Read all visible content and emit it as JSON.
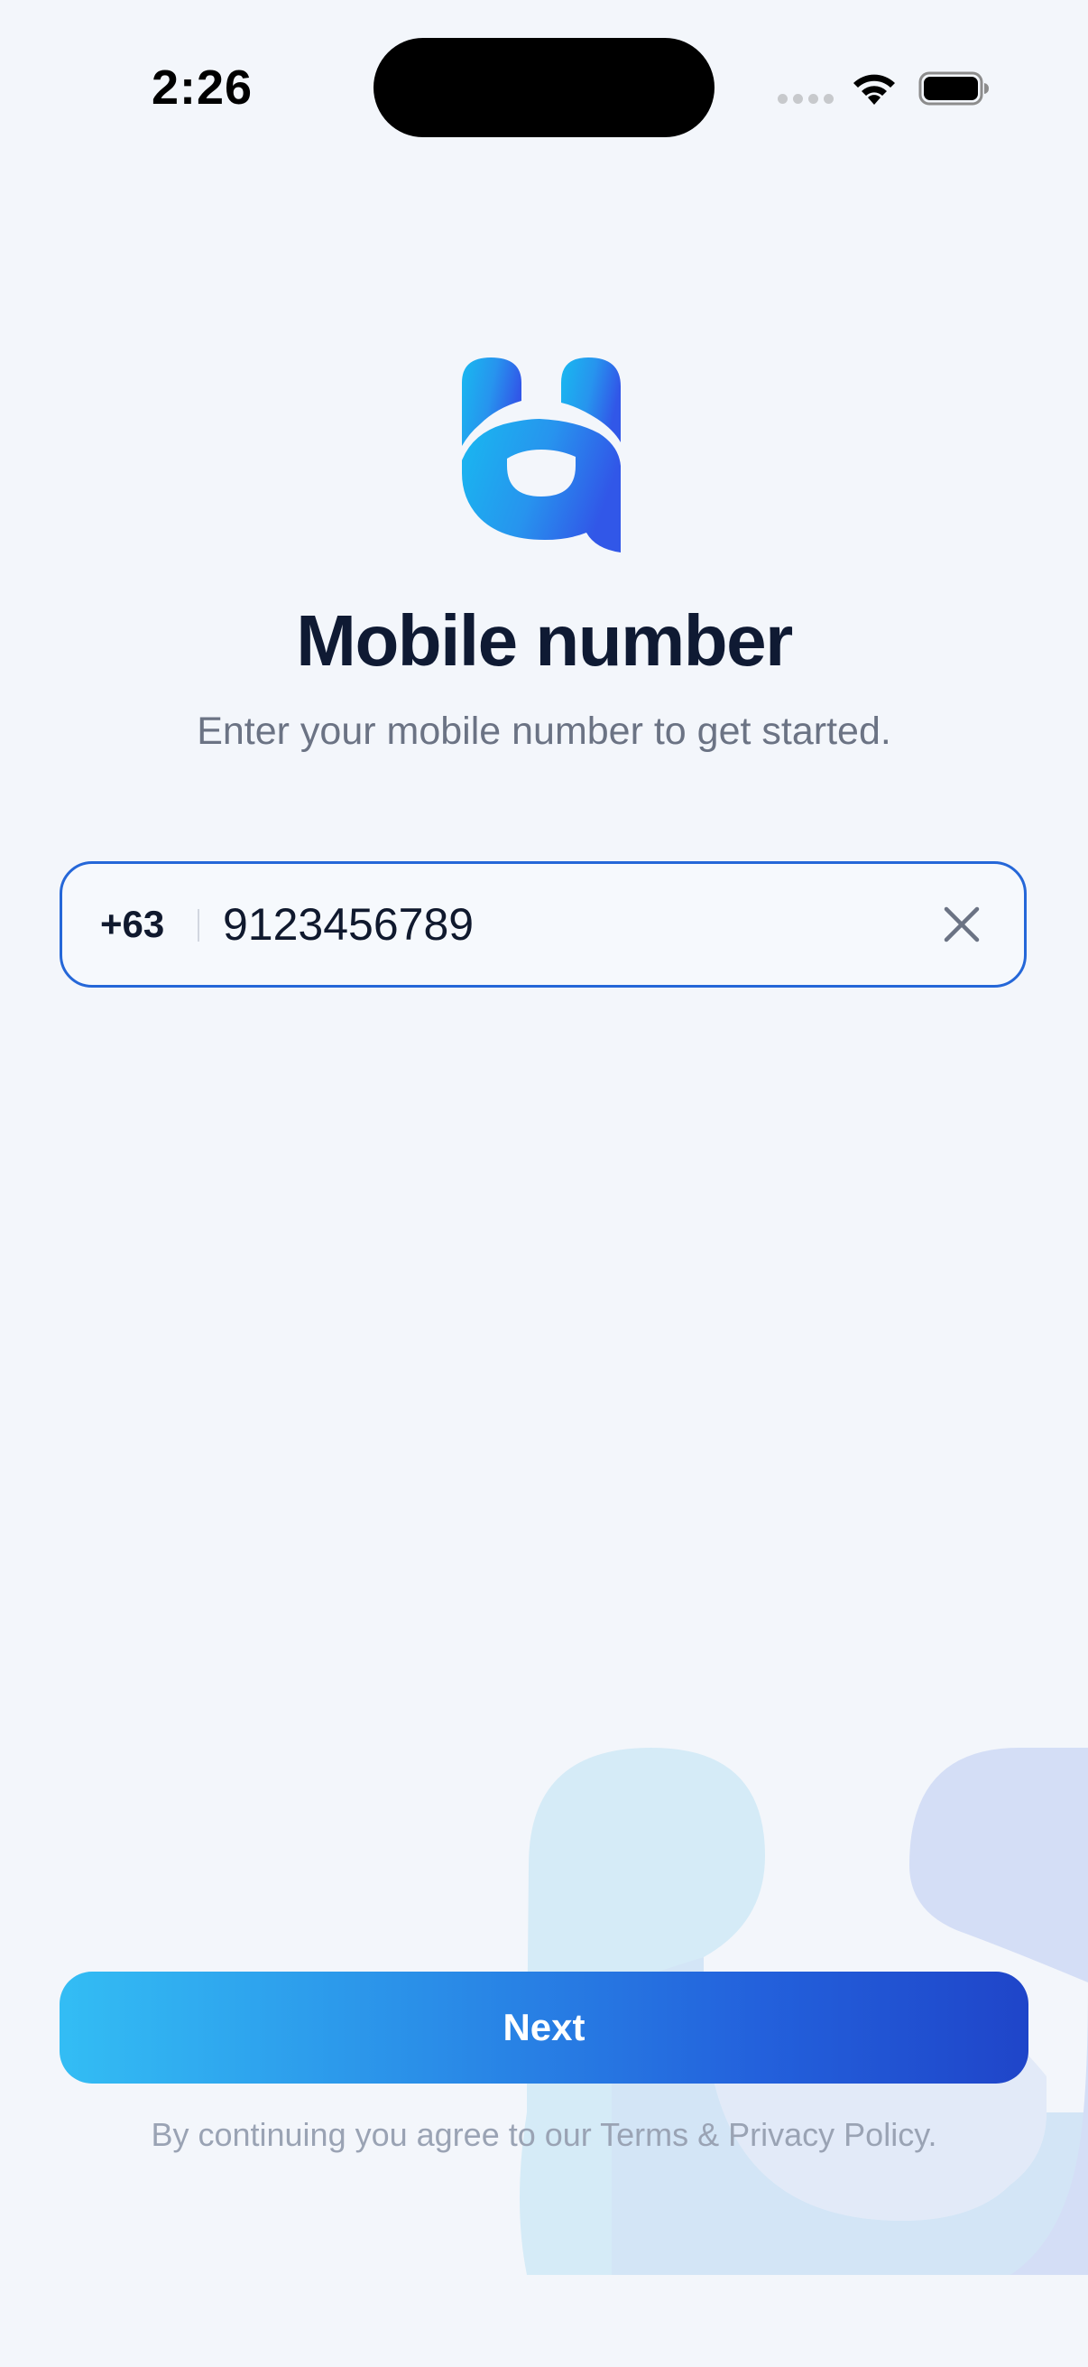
{
  "status_bar": {
    "time": "2:26",
    "icons": [
      "signal-dots-icon",
      "wifi-icon",
      "battery-icon"
    ]
  },
  "logo": {
    "icon": "brand-logo-icon",
    "colors": {
      "start": "#18b9f0",
      "end": "#3157e8"
    }
  },
  "header": {
    "title": "Mobile number",
    "subtitle": "Enter your mobile number to get started."
  },
  "phone_field": {
    "country_code": "+63",
    "value": "9123456789",
    "clear_icon": "close-icon",
    "border_color": "#2567d8"
  },
  "next_button": {
    "label": "Next",
    "gradient": [
      "#33bdf4",
      "#1f45c9"
    ]
  },
  "footer": {
    "terms_prefix": "By continuing you agree to our ",
    "terms_link": "Terms & Privacy Policy",
    "terms_suffix": "."
  },
  "colors": {
    "background": "#f3f6fb",
    "title": "#0f1a33",
    "subtitle": "#6b7384",
    "accent": "#2567d8"
  }
}
